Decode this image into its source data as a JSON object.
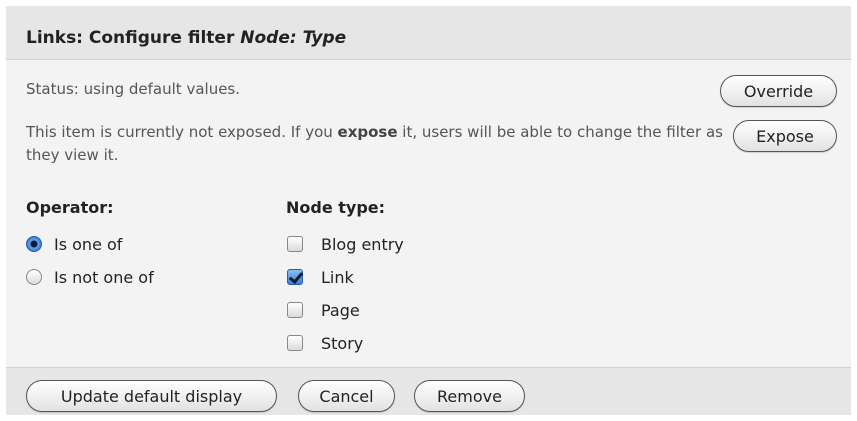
{
  "title": {
    "prefix": "Links: Configure filter ",
    "emphasis": "Node: Type"
  },
  "status": {
    "text": "Status: using default values.",
    "override_label": "Override"
  },
  "exposure": {
    "text_before": "This item is currently not exposed. If you ",
    "bold_word": "expose",
    "text_after": " it, users will be able to change the filter as they view it.",
    "expose_label": "Expose"
  },
  "operator": {
    "heading": "Operator:",
    "options": [
      {
        "label": "Is one of",
        "selected": true
      },
      {
        "label": "Is not one of",
        "selected": false
      }
    ]
  },
  "node_type": {
    "heading": "Node type:",
    "options": [
      {
        "label": "Blog entry",
        "checked": false
      },
      {
        "label": "Link",
        "checked": true
      },
      {
        "label": "Page",
        "checked": false
      },
      {
        "label": "Story",
        "checked": false
      }
    ]
  },
  "footer": {
    "update_label": "Update default display",
    "cancel_label": "Cancel",
    "remove_label": "Remove"
  },
  "colors": {
    "panel_bg": "#f3f3f3",
    "header_bg": "#e6e6e6",
    "accent": "#3a7fd6"
  }
}
